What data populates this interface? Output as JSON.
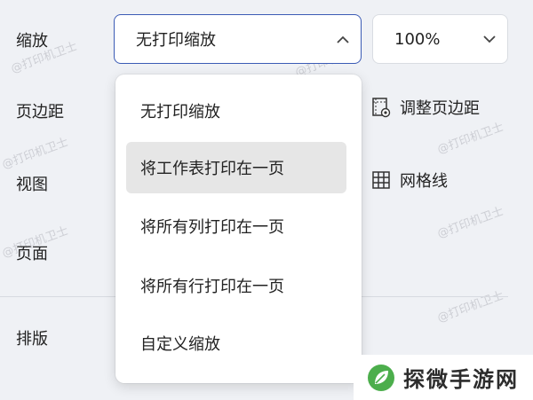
{
  "labels": {
    "scaling": "缩放",
    "margins": "页边距",
    "view": "视图",
    "page": "页面",
    "layout": "排版"
  },
  "scaling_select": {
    "value": "无打印缩放"
  },
  "zoom_select": {
    "value": "100%"
  },
  "side_tools": {
    "adjust_margins": "调整页边距",
    "gridlines": "网格线"
  },
  "dropdown": {
    "options": [
      {
        "label": "无打印缩放"
      },
      {
        "label": "将工作表打印在一页",
        "selected": true
      },
      {
        "label": "将所有列打印在一页"
      },
      {
        "label": "将所有行打印在一页"
      },
      {
        "label": "自定义缩放"
      }
    ]
  },
  "watermark": "@打印机卫士",
  "brand": {
    "name": "探微手游网"
  },
  "colors": {
    "focus_border": "#3b5bb5",
    "brand_green": "#4cae4c",
    "background": "#eff1f5"
  }
}
